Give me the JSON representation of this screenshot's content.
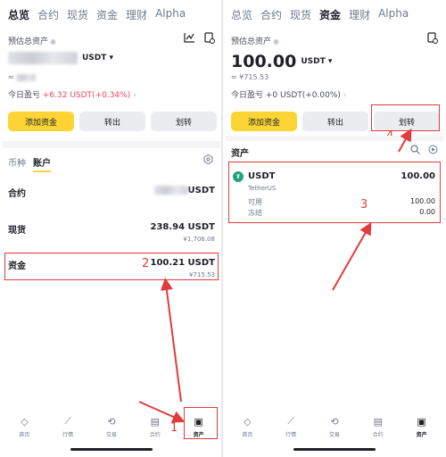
{
  "tabs": [
    "总览",
    "合约",
    "现货",
    "资金",
    "理财",
    "Alpha"
  ],
  "left": {
    "est_label": "预估总资产",
    "total_unit": "USDT ▾",
    "approx_prefix": "≈",
    "pnl_label": "今日盈亏",
    "pnl_value": "+6.32 USDT(+0.34%)",
    "buttons": [
      "添加资金",
      "转出",
      "划转"
    ],
    "subtabs": [
      "币种",
      "账户"
    ],
    "rows": [
      {
        "label": "合约",
        "value": "USDT",
        "sub": ""
      },
      {
        "label": "现货",
        "value": "238.94 USDT",
        "sub": "¥1,706.08"
      },
      {
        "label": "资金",
        "value": "100.21 USDT",
        "sub": "¥715.53"
      }
    ],
    "annotations": {
      "a1": "1",
      "a2": "2"
    }
  },
  "right": {
    "est_label": "预估总资产",
    "total_value": "100.00",
    "total_unit": "USDT ▾",
    "approx": "≈ ¥715.53",
    "pnl_label": "今日盈亏",
    "pnl_value": "+0 USDT(+0.00%)",
    "buttons": [
      "添加资金",
      "转出",
      "划转"
    ],
    "section_title": "资产",
    "asset": {
      "name": "USDT",
      "full_name": "TetherUS",
      "total": "100.00",
      "available_label": "可用",
      "available": "100.00",
      "frozen_label": "冻结",
      "frozen": "0.00"
    },
    "annotations": {
      "a3": "3",
      "a4": "4"
    }
  },
  "nav": [
    "首页",
    "行情",
    "交易",
    "合约",
    "资产"
  ],
  "colors": {
    "accent": "#fcd535",
    "annotation": "#e23b3b",
    "up": "#f6465d",
    "usdt": "#26a17b"
  }
}
